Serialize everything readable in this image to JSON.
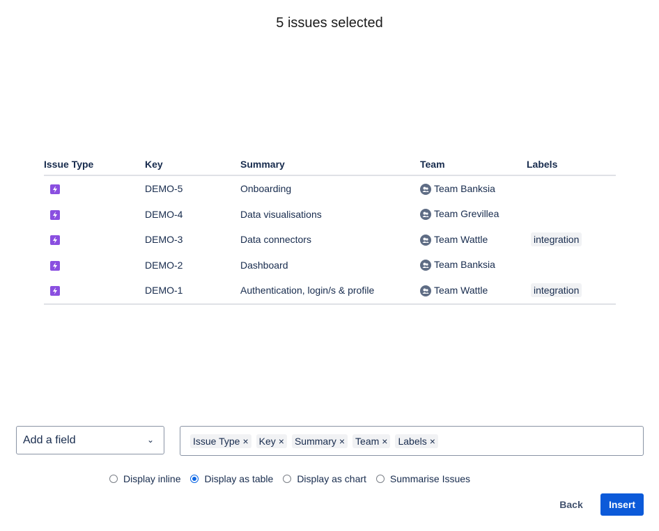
{
  "header": {
    "title": "5 issues selected"
  },
  "table": {
    "columns": [
      "Issue Type",
      "Key",
      "Summary",
      "Team",
      "Labels"
    ],
    "rows": [
      {
        "type_icon": "epic-icon",
        "key": "DEMO-5",
        "summary": "Onboarding",
        "team": "Team Banksia",
        "label": ""
      },
      {
        "type_icon": "epic-icon",
        "key": "DEMO-4",
        "summary": "Data visualisations",
        "team": "Team Grevillea",
        "label": ""
      },
      {
        "type_icon": "epic-icon",
        "key": "DEMO-3",
        "summary": "Data connectors",
        "team": "Team Wattle",
        "label": "integration"
      },
      {
        "type_icon": "epic-icon",
        "key": "DEMO-2",
        "summary": "Dashboard",
        "team": "Team Banksia",
        "label": ""
      },
      {
        "type_icon": "epic-icon",
        "key": "DEMO-1",
        "summary": "Authentication, login/s & profile",
        "team": "Team Wattle",
        "label": "integration"
      }
    ]
  },
  "field_select": {
    "placeholder": "Add a field",
    "chevron": "chevron-down-icon"
  },
  "fields": [
    {
      "label": "Issue Type",
      "remove": "×"
    },
    {
      "label": "Key",
      "remove": "×"
    },
    {
      "label": "Summary",
      "remove": "×"
    },
    {
      "label": "Team",
      "remove": "×"
    },
    {
      "label": "Labels",
      "remove": "×"
    }
  ],
  "display_options": [
    {
      "label": "Display inline",
      "selected": false
    },
    {
      "label": "Display as table",
      "selected": true
    },
    {
      "label": "Display as chart",
      "selected": false
    },
    {
      "label": "Summarise Issues",
      "selected": false
    }
  ],
  "actions": {
    "back": "Back",
    "insert": "Insert"
  },
  "colors": {
    "accent": "#0c5ad9",
    "epic": "#8a4fe0",
    "team_icon": "#5e6c84"
  }
}
